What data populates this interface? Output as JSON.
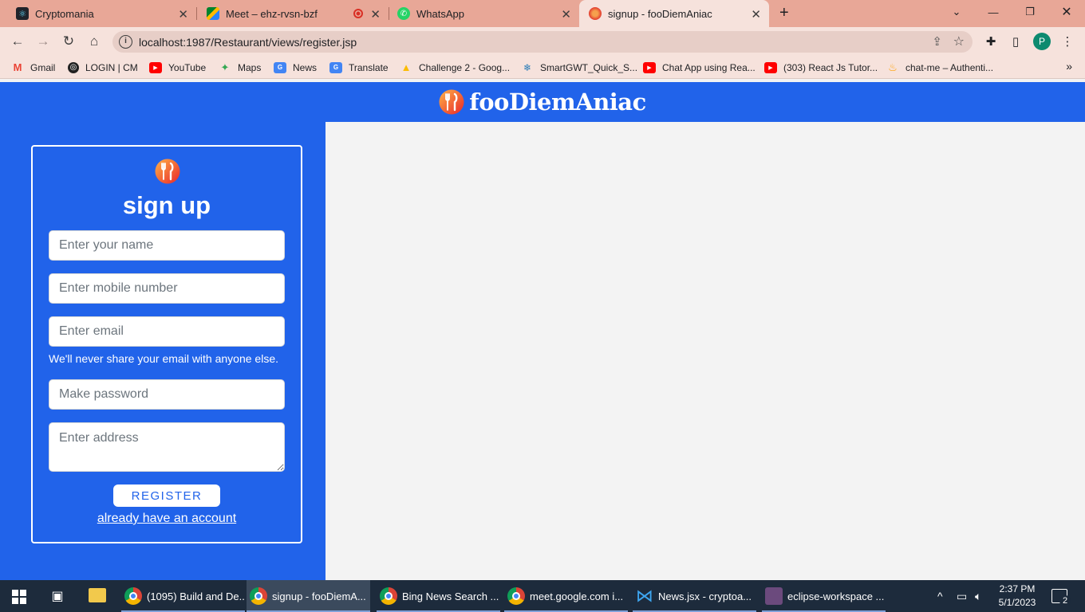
{
  "browser": {
    "tabs": [
      {
        "title": "Cryptomania",
        "icon": "react-icon"
      },
      {
        "title": "Meet – ehz-rvsn-bzf",
        "icon": "meet-icon"
      },
      {
        "title": "WhatsApp",
        "icon": "whatsapp-icon"
      },
      {
        "title": "signup - fooDiemAniac",
        "icon": "fork-knife-icon"
      }
    ],
    "url": "localhost:1987/Restaurant/views/register.jsp",
    "profile_initial": "P",
    "bookmarks": [
      {
        "label": "Gmail"
      },
      {
        "label": "LOGIN | CM"
      },
      {
        "label": "YouTube"
      },
      {
        "label": "Maps"
      },
      {
        "label": "News"
      },
      {
        "label": "Translate"
      },
      {
        "label": "Challenge 2 - Goog..."
      },
      {
        "label": "SmartGWT_Quick_S..."
      },
      {
        "label": "Chat App using Rea..."
      },
      {
        "label": "(303) React Js Tutor..."
      },
      {
        "label": "chat-me – Authenti..."
      }
    ]
  },
  "site": {
    "brand": "fooDiemAniac",
    "accent_color": "#2163ea"
  },
  "signup": {
    "title": "sign up",
    "name_placeholder": "Enter your name",
    "mobile_placeholder": "Enter mobile number",
    "email_placeholder": "Enter email",
    "email_help": "We'll never share your email with anyone else.",
    "password_placeholder": "Make password",
    "address_placeholder": "Enter address",
    "register_label": "REGISTER",
    "login_link": "already have an account"
  },
  "taskbar": {
    "items": [
      {
        "label": "(1095) Build and De..."
      },
      {
        "label": "signup - fooDiemA..."
      },
      {
        "label": "Bing News Search ..."
      },
      {
        "label": "meet.google.com i..."
      },
      {
        "label": "News.jsx - cryptoa..."
      },
      {
        "label": "eclipse-workspace ..."
      }
    ],
    "time": "2:37 PM",
    "date": "5/1/2023",
    "notification_count": "2"
  }
}
